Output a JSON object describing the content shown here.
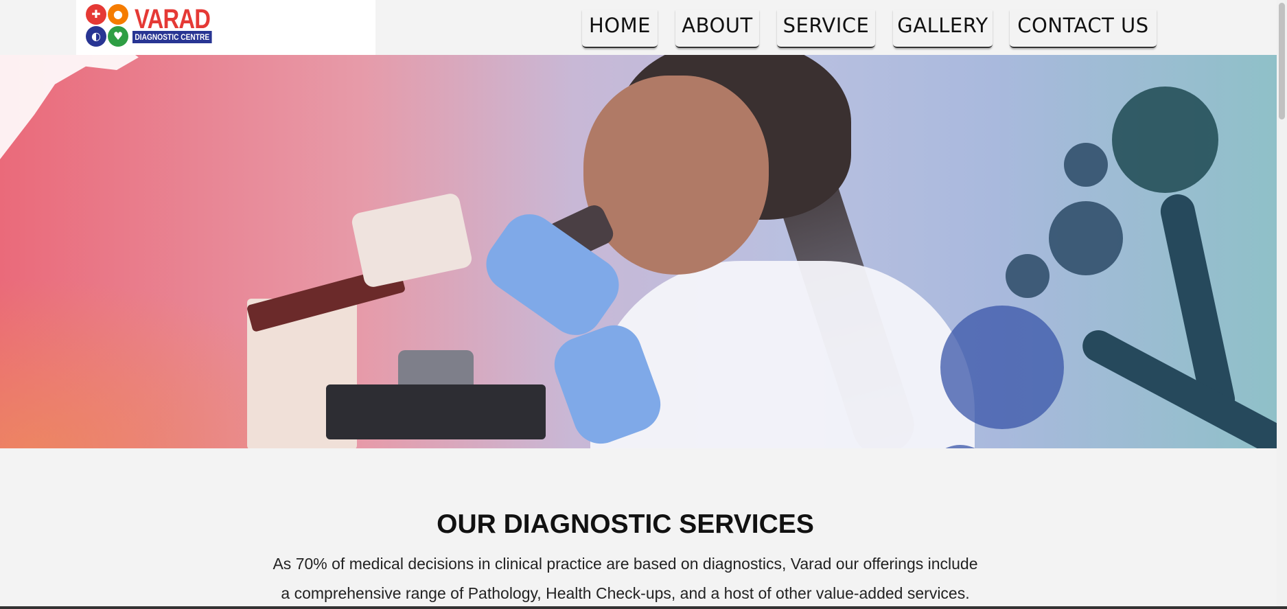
{
  "brand": {
    "name": "VARAD",
    "subtitle": "DIAGNOSTIC CENTRE",
    "colors": {
      "red": "#e53935",
      "navy": "#283593",
      "orange": "#f57c00",
      "green": "#2e9e44"
    }
  },
  "nav": {
    "items": [
      {
        "label": "HOME"
      },
      {
        "label": "ABOUT"
      },
      {
        "label": "SERVICE"
      },
      {
        "label": "GALLERY"
      },
      {
        "label": "CONTACT US"
      }
    ]
  },
  "hero": {
    "image": "lab-scientist-microscope-banner"
  },
  "services": {
    "title": "OUR DIAGNOSTIC SERVICES",
    "description_lines": [
      "As 70% of medical decisions in clinical practice are based on diagnostics, Varad our offerings include",
      "a comprehensive range of Pathology, Health Check-ups, and a host of other value-added services."
    ]
  }
}
